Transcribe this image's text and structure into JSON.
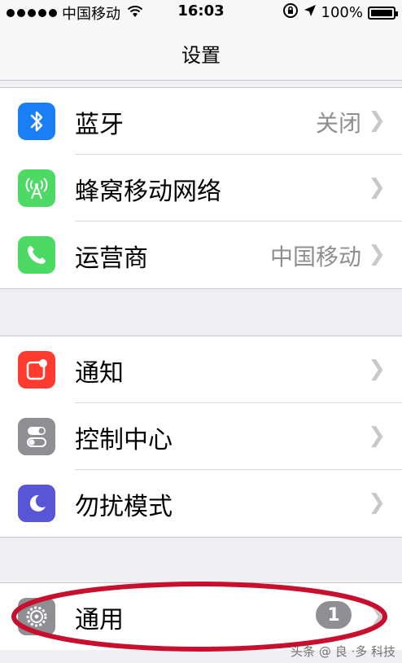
{
  "status_bar": {
    "carrier": "中国移动",
    "time": "16:03",
    "battery": "100%",
    "battery_level": 1.0
  },
  "nav": {
    "title": "设置"
  },
  "colors": {
    "bluetooth": "#1a7ef5",
    "cellular": "#4cd964",
    "carrier": "#4cd964",
    "notifications": "#ff3b30",
    "control_center": "#8e8e93",
    "dnd": "#5856d6",
    "general": "#8e8e93",
    "annotation": "#c8102e"
  },
  "groups": [
    {
      "items": [
        {
          "label": "蓝牙",
          "value": "关闭",
          "icon": "bluetooth-icon"
        },
        {
          "label": "蜂窝移动网络",
          "value": "",
          "icon": "cellular-antenna-icon"
        },
        {
          "label": "运营商",
          "value": "中国移动",
          "icon": "phone-icon"
        }
      ]
    },
    {
      "items": [
        {
          "label": "通知",
          "icon": "notifications-icon"
        },
        {
          "label": "控制中心",
          "icon": "control-center-icon"
        },
        {
          "label": "勿扰模式",
          "icon": "moon-icon"
        }
      ]
    },
    {
      "items": [
        {
          "label": "通用",
          "badge": "1",
          "icon": "gear-icon"
        }
      ]
    }
  ],
  "watermark": "头条 @ 良 ·多 科技"
}
